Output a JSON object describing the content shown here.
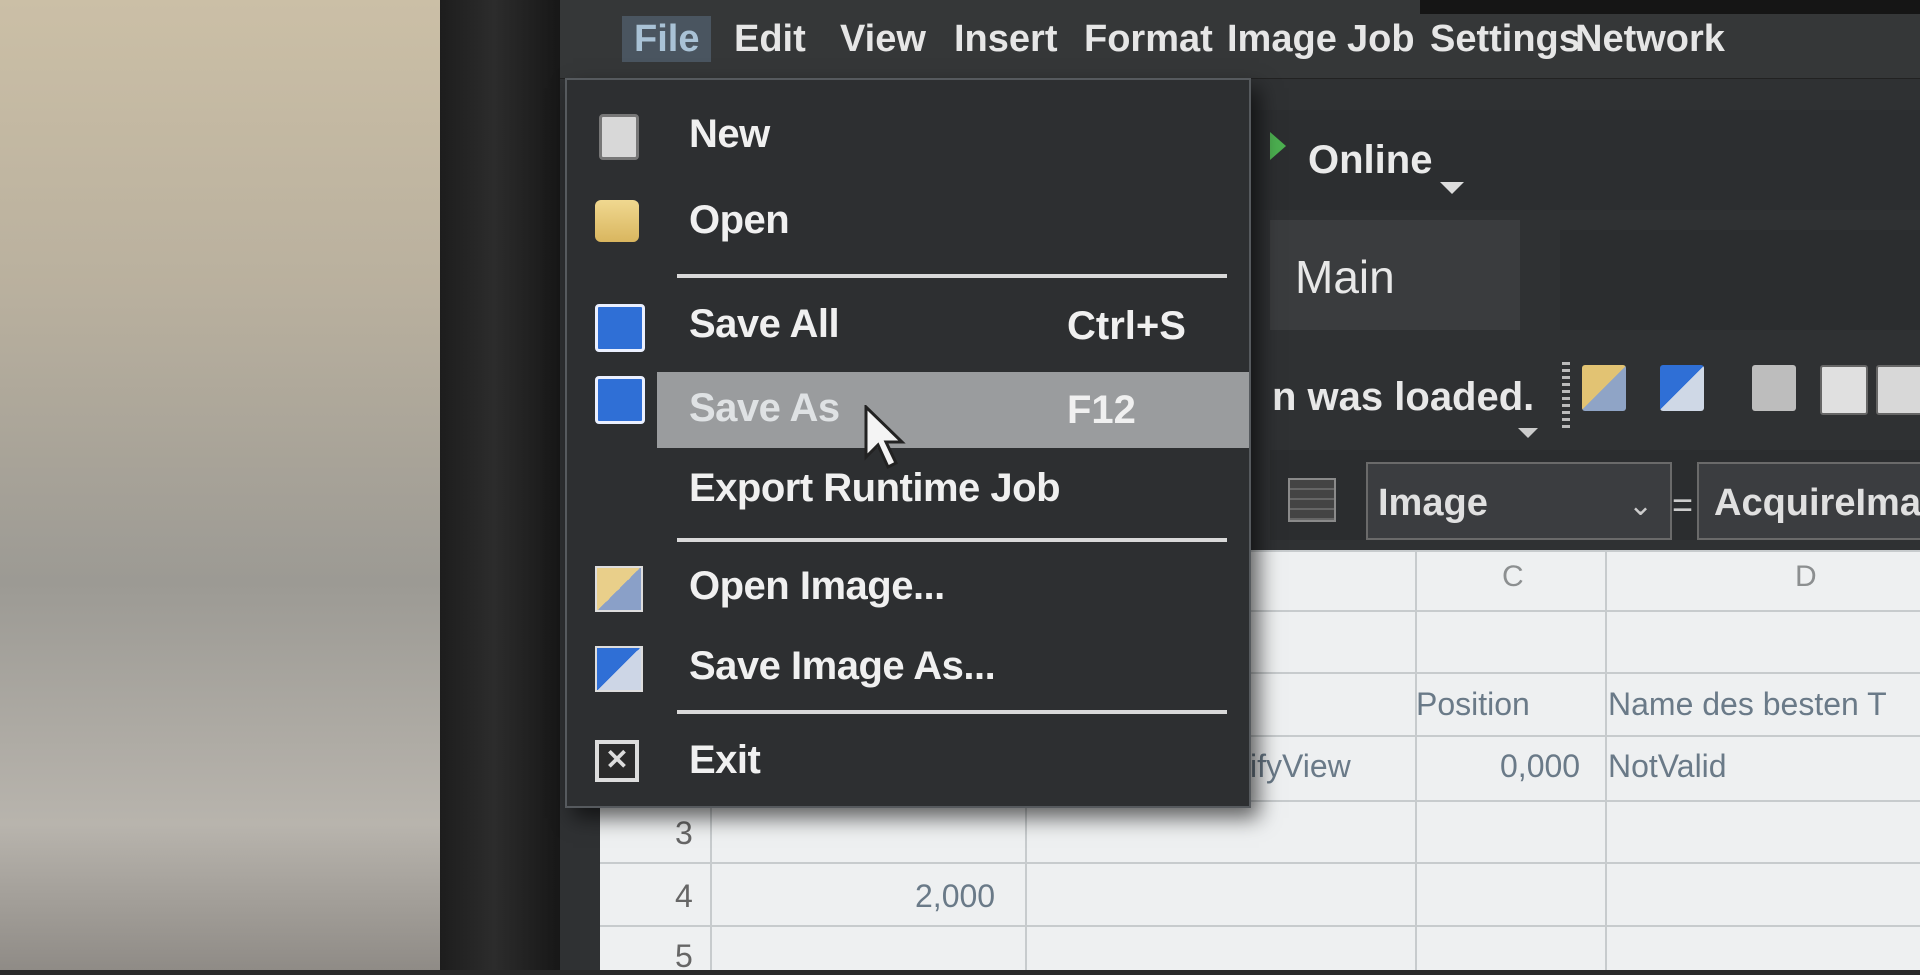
{
  "menubar": {
    "items": [
      "File",
      "Edit",
      "View",
      "Insert",
      "Format",
      "Image",
      "Job",
      "Settings",
      "Network"
    ]
  },
  "toolbar": {
    "online_label": "Online",
    "tab_main": "Main",
    "status_message": "n was loaded."
  },
  "formula": {
    "cell_ref": "Image",
    "formula_text": "AcquireImage"
  },
  "file_menu": {
    "items": [
      {
        "label": "New",
        "shortcut": "",
        "icon": "new-file-icon"
      },
      {
        "label": "Open",
        "shortcut": "",
        "icon": "open-folder-icon"
      },
      {
        "label": "Save All",
        "shortcut": "Ctrl+S",
        "icon": "save-icon"
      },
      {
        "label": "Save As",
        "shortcut": "F12",
        "icon": "save-as-icon"
      },
      {
        "label": "Export Runtime Job",
        "shortcut": "",
        "icon": ""
      },
      {
        "label": "Open Image...",
        "shortcut": "",
        "icon": "open-image-icon"
      },
      {
        "label": "Save Image As...",
        "shortcut": "",
        "icon": "save-image-icon"
      },
      {
        "label": "Exit",
        "shortcut": "",
        "icon": "exit-icon"
      }
    ],
    "highlighted": "Save As"
  },
  "sheet": {
    "columns": [
      "C",
      "D"
    ],
    "rows": [
      "3",
      "4",
      "5"
    ],
    "cells": {
      "c_header": "Position",
      "d_header": "Name des besten T",
      "b_row2": "ifyView",
      "c_row2": "0,000",
      "d_row2": "NotValid",
      "a_row4": "2,000"
    }
  },
  "colors": {
    "menu_bg": "#2d2f31",
    "highlight": "#9a9c9e",
    "active_menu": "#4a5560",
    "online_green": "#4caf50"
  }
}
